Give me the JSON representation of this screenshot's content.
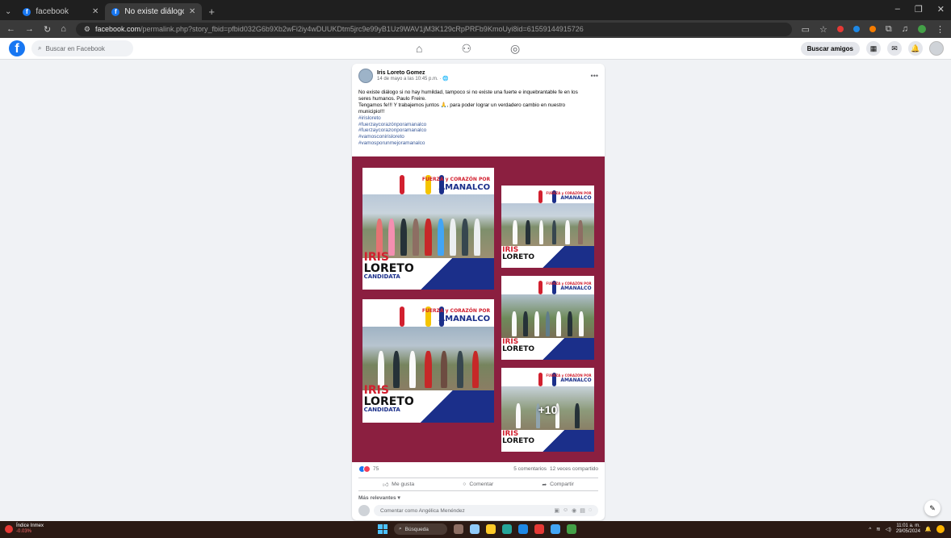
{
  "browser": {
    "tabs": [
      {
        "title": "facebook",
        "active": false
      },
      {
        "title": "No existe diálogo si no hay hu...",
        "active": true
      }
    ],
    "url_host": "facebook.com",
    "url_path": "/permalink.php?story_fbid=pfbid032G6b9Xb2wFi2iy4wDUUKDtm5jrc9e99yB1Uz9WAV1jM3K129cRpPRFb9KmoUyi8id=61559144915726"
  },
  "facebook": {
    "search_placeholder": "Buscar en Facebook",
    "find_friends": "Buscar amigos"
  },
  "post": {
    "author": "Iris Loreto Gomez",
    "date": "14 de mayo a las 10:45 p.m.",
    "text_lines": [
      "No existe diálogo si no hay humildad, tampoco si no existe una fuerte e inquebrantable fe en los",
      "seres humanos. Paulo Freire.",
      "Tengamos fe!!! Y trabajemos juntos 🙏, para poder lograr un verdadero cambio en nuestro",
      "municipio!!!"
    ],
    "hashtags": [
      "#irisloreto",
      "#fuerzaycorazónporamanalco",
      "#fuerzaycorazonporamanalco",
      "#vamosconirisloreto",
      "#vamosporunmejoramanalco"
    ],
    "photo_text": {
      "slogan": "FUERZA y CORAZÓN POR",
      "place": "AMANALCO",
      "name_top": "IRIS",
      "name_bottom": "LORETO",
      "role": "CANDIDATA",
      "more": "+10"
    },
    "reaction_count": "75",
    "comments": "5 comentarios",
    "shares": "12 veces compartido",
    "actions": {
      "like": "Me gusta",
      "comment": "Comentar",
      "share": "Compartir"
    },
    "relevance": "Más relevantes",
    "comment_placeholder": "Comentar como Angélica Menéndez"
  },
  "taskbar": {
    "widget_title": "Índice Inmex",
    "widget_value": "-0.03%",
    "search": "Búsqueda",
    "time": "11:01 a. m.",
    "date": "29/05/2024"
  },
  "colors": {
    "fb_blue": "#1877f2",
    "media_bg": "#8b1f40",
    "campaign_red": "#d2202f",
    "campaign_blue": "#1b2f8a"
  }
}
